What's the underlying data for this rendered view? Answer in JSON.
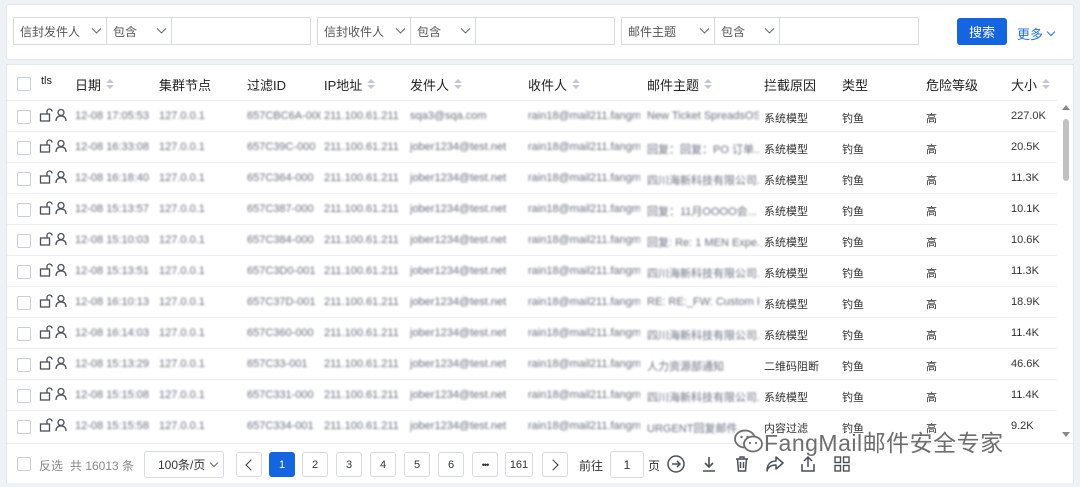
{
  "filters": [
    {
      "field": "信封发件人",
      "op": "包含",
      "value": ""
    },
    {
      "field": "信封收件人",
      "op": "包含",
      "value": ""
    },
    {
      "field": "邮件主题",
      "op": "包含",
      "value": ""
    }
  ],
  "search_label": "搜索",
  "more_label": "更多",
  "columns": {
    "tls": "tls",
    "date": "日期",
    "node": "集群节点",
    "filter_id": "过滤ID",
    "ip": "IP地址",
    "sender": "发件人",
    "recipient": "收件人",
    "subject": "邮件主题",
    "reason": "拦截原因",
    "type": "类型",
    "risk": "危险等级",
    "size": "大小"
  },
  "rows": [
    {
      "date": "12-08 17:05:53",
      "node": "127.0.0.1",
      "fid": "657CBC6A-000",
      "ip": "211.100.61.211",
      "sender": "sqa3@sqa.com",
      "recipient": "rain18@mail211.fangma...",
      "subject": "New Ticket SpreadsOST...",
      "reason": "系统模型",
      "type": "钓鱼",
      "risk": "高",
      "size": "227.0K"
    },
    {
      "date": "12-08 16:33:08",
      "node": "127.0.0.1",
      "fid": "657C39C-000",
      "ip": "211.100.61.211",
      "sender": "jober1234@test.net",
      "recipient": "rain18@mail211.fangma...",
      "subject": "回复：回复：PO 订单...",
      "reason": "系统模型",
      "type": "钓鱼",
      "risk": "高",
      "size": "20.5K"
    },
    {
      "date": "12-08 16:18:40",
      "node": "127.0.0.1",
      "fid": "657C364-000",
      "ip": "211.100.61.211",
      "sender": "jober1234@test.net",
      "recipient": "rain18@mail211.fangma...",
      "subject": "四川海新科技有限公司...",
      "reason": "系统模型",
      "type": "钓鱼",
      "risk": "高",
      "size": "11.3K"
    },
    {
      "date": "12-08 15:13:57",
      "node": "127.0.0.1",
      "fid": "657C387-000",
      "ip": "211.100.61.211",
      "sender": "jober1234@test.net",
      "recipient": "rain18@mail211.fangma...",
      "subject": "回复：11月OOOO会...",
      "reason": "系统模型",
      "type": "钓鱼",
      "risk": "高",
      "size": "10.1K"
    },
    {
      "date": "12-08 15:10:03",
      "node": "127.0.0.1",
      "fid": "657C384-000",
      "ip": "211.100.61.211",
      "sender": "jober1234@test.net",
      "recipient": "rain18@mail211.fangma...",
      "subject": "回复: Re: 1 MEN Expe...",
      "reason": "系统模型",
      "type": "钓鱼",
      "risk": "高",
      "size": "10.6K"
    },
    {
      "date": "12-08 15:13:51",
      "node": "127.0.0.1",
      "fid": "657C3D0-001",
      "ip": "211.100.61.211",
      "sender": "jober1234@test.net",
      "recipient": "rain18@mail211.fangma...",
      "subject": "四川海新科技有限公司...",
      "reason": "系统模型",
      "type": "钓鱼",
      "risk": "高",
      "size": "11.3K"
    },
    {
      "date": "12-08 16:10:13",
      "node": "127.0.0.1",
      "fid": "657C37D-001",
      "ip": "211.100.61.211",
      "sender": "jober1234@test.net",
      "recipient": "rain18@mail211.fangma...",
      "subject": "RE: RE:_FW: Custom Fu...",
      "reason": "系统模型",
      "type": "钓鱼",
      "risk": "高",
      "size": "18.9K"
    },
    {
      "date": "12-08 16:14:03",
      "node": "127.0.0.1",
      "fid": "657C360-000",
      "ip": "211.100.61.211",
      "sender": "jober1234@test.net",
      "recipient": "rain18@mail211.fangma...",
      "subject": "四川海新科技有限公司...",
      "reason": "系统模型",
      "type": "钓鱼",
      "risk": "高",
      "size": "11.4K"
    },
    {
      "date": "12-08 15:13:29",
      "node": "127.0.0.1",
      "fid": "657C33-001",
      "ip": "211.100.61.211",
      "sender": "jober1234@test.net",
      "recipient": "rain18@mail211.fangma...",
      "subject": "人力资源部通知",
      "reason": "二维码阻断",
      "type": "钓鱼",
      "risk": "高",
      "size": "46.6K"
    },
    {
      "date": "12-08 15:15:08",
      "node": "127.0.0.1",
      "fid": "657C331-000",
      "ip": "211.100.61.211",
      "sender": "jober1234@test.net",
      "recipient": "rain18@mail211.fangma...",
      "subject": "四川海新科技有限公司...",
      "reason": "系统模型",
      "type": "钓鱼",
      "risk": "高",
      "size": "11.4K"
    },
    {
      "date": "12-08 15:15:58",
      "node": "127.0.0.1",
      "fid": "657C334-001",
      "ip": "211.100.61.211",
      "sender": "jober1234@test.net",
      "recipient": "rain18@mail211.fangma...",
      "subject": "URGENT回复邮件...",
      "reason": "内容过滤",
      "type": "钓鱼",
      "risk": "高",
      "size": "9.2K"
    }
  ],
  "footer": {
    "invert_label": "反选",
    "total_label": "共 16013 条",
    "page_size": "100条/页",
    "pages": [
      "1",
      "2",
      "3",
      "4",
      "5",
      "6",
      "•••",
      "161"
    ],
    "current_page": "1",
    "goto_label": "前往",
    "goto_value": "1",
    "page_unit": "页"
  },
  "watermark": "FangMail邮件安全专家",
  "colors": {
    "accent": "#1565e0",
    "link": "#1f6fe8"
  }
}
